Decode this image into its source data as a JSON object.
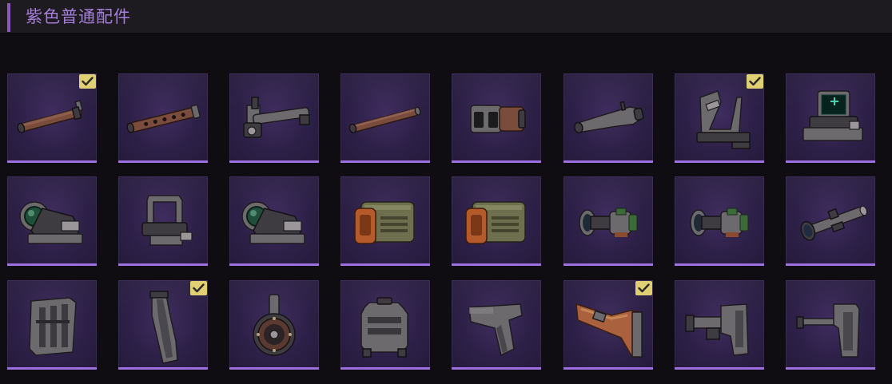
{
  "header": {
    "title": "紫色普通配件"
  },
  "colors": {
    "accent": "#8a57c4",
    "title": "#a57fd9",
    "tile_bottom": "#9e6fe0",
    "check": "#e1cf73"
  },
  "rows": [
    {
      "items": [
        {
          "icon": "long-barrel-icon",
          "checked": true
        },
        {
          "icon": "perforated-barrel-icon",
          "checked": false
        },
        {
          "icon": "barrel-with-sight-icon",
          "checked": false
        },
        {
          "icon": "thin-barrel-icon",
          "checked": false
        },
        {
          "icon": "muzzle-brake-icon",
          "checked": false
        },
        {
          "icon": "flash-hider-icon",
          "checked": false
        },
        {
          "icon": "iron-sight-mount-icon",
          "checked": true
        },
        {
          "icon": "holographic-sight-icon",
          "checked": false
        }
      ]
    },
    {
      "items": [
        {
          "icon": "reflex-sight-icon",
          "checked": false
        },
        {
          "icon": "rear-sight-icon",
          "checked": false
        },
        {
          "icon": "reflex-sight-icon",
          "checked": false
        },
        {
          "icon": "battery-module-icon",
          "checked": false
        },
        {
          "icon": "battery-module-icon",
          "checked": false
        },
        {
          "icon": "scope-short-icon",
          "checked": false
        },
        {
          "icon": "scope-short-icon",
          "checked": false
        },
        {
          "icon": "long-scope-icon",
          "checked": false
        }
      ]
    },
    {
      "items": [
        {
          "icon": "box-magazine-icon",
          "checked": false
        },
        {
          "icon": "curved-magazine-icon",
          "checked": true
        },
        {
          "icon": "drum-magazine-icon",
          "checked": false
        },
        {
          "icon": "ammo-box-icon",
          "checked": false
        },
        {
          "icon": "pistol-grip-icon",
          "checked": false
        },
        {
          "icon": "wooden-stock-icon",
          "checked": true
        },
        {
          "icon": "adjustable-stock-icon",
          "checked": false
        },
        {
          "icon": "skeleton-stock-icon",
          "checked": false
        }
      ]
    }
  ]
}
